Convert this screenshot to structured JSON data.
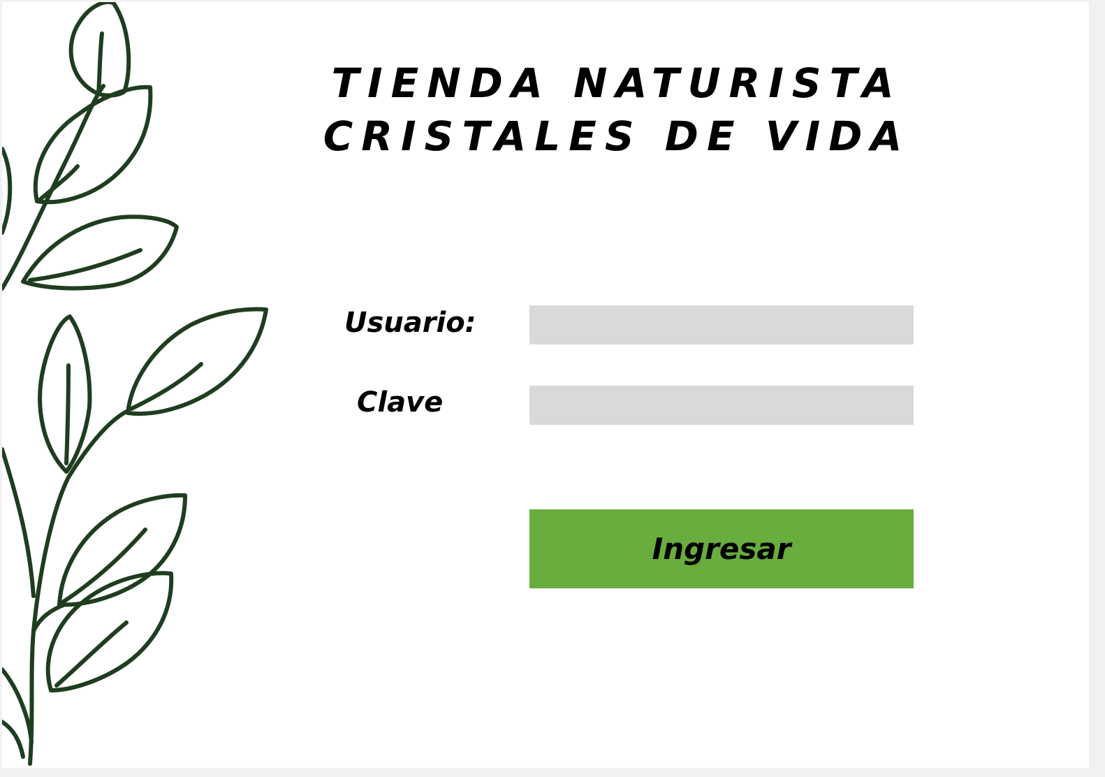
{
  "header": {
    "title_line1": "TIENDA NATURISTA",
    "title_line2": "CRISTALES DE VIDA"
  },
  "form": {
    "user_label": "Usuario:",
    "user_value": "",
    "password_label": "Clave",
    "password_value": "",
    "submit_label": "Ingresar"
  },
  "colors": {
    "leaf_stroke": "#1f3d1f",
    "field_background": "#d9d9d9",
    "button_background": "#68ad3d"
  },
  "icons": {
    "decoration": "leaf-branch-icon"
  }
}
